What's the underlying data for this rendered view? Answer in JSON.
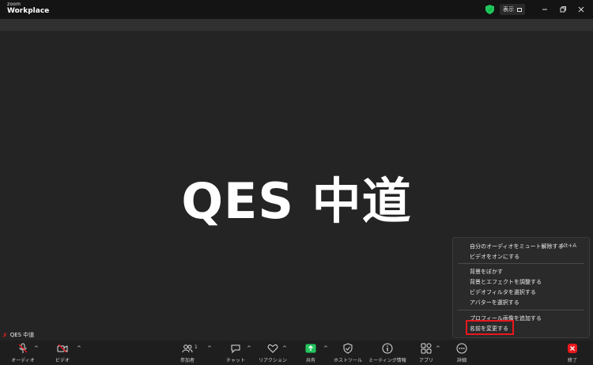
{
  "app": {
    "logo_top": "zoom",
    "logo_bottom": "Workplace",
    "view_label": "表示"
  },
  "participant": {
    "display_name": "QES 中道",
    "name_tag": "QES 中道"
  },
  "menu": {
    "mute_label": "自分のオーディオをミュート解除する",
    "mute_shortcut": "Alt+A",
    "video_on_label": "ビデオをオンにする",
    "blur_label": "背景をぼかす",
    "bg_effects_label": "背景とエフェクトを調整する",
    "filter_label": "ビデオフィルタを選択する",
    "avatar_label": "アバターを選択する",
    "profile_pic_label": "プロフィール画像を追加する",
    "rename_label": "名前を変更する"
  },
  "toolbar": {
    "audio": "オーディオ",
    "video": "ビデオ",
    "participants": "参加者",
    "participants_count": "1",
    "chat": "チャット",
    "reactions": "リアクション",
    "share": "共有",
    "host_tools": "ホストツール",
    "meeting_info": "ミーティング情報",
    "apps": "アプリ",
    "more": "詳細",
    "end": "終了"
  },
  "colors": {
    "accent_red": "#e8181e",
    "share_green": "#22c55e",
    "shield_green": "#22c55e"
  }
}
